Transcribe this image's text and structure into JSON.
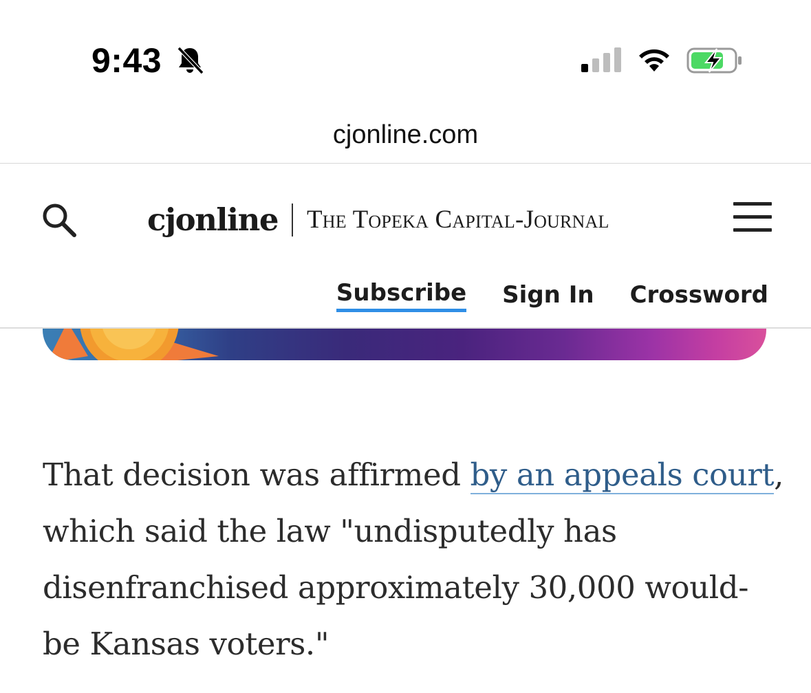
{
  "status_bar": {
    "time": "9:43",
    "icons": {
      "silent": "bell-slash-icon",
      "signal": "cellular-signal-icon",
      "wifi": "wifi-icon",
      "battery": "battery-charging-icon"
    },
    "battery_color": "#4cd964"
  },
  "browser": {
    "url": "cjonline.com"
  },
  "header": {
    "search_icon": "search-icon",
    "logo": "cjonline",
    "paper_name": "The Topeka Capital-Journal",
    "menu_icon": "hamburger-menu-icon",
    "nav": {
      "subscribe": "Subscribe",
      "sign_in": "Sign In",
      "crossword": "Crossword"
    },
    "accent_color": "#2f8ee6"
  },
  "article": {
    "text_before_link": "That decision was affirmed ",
    "link_text": "by an appeals court",
    "text_after_link": ", which said the law \"undisputedly has disenfranchised approximately 30,000 would-be Kansas voters.\"",
    "link_color": "#2f5d8a"
  }
}
